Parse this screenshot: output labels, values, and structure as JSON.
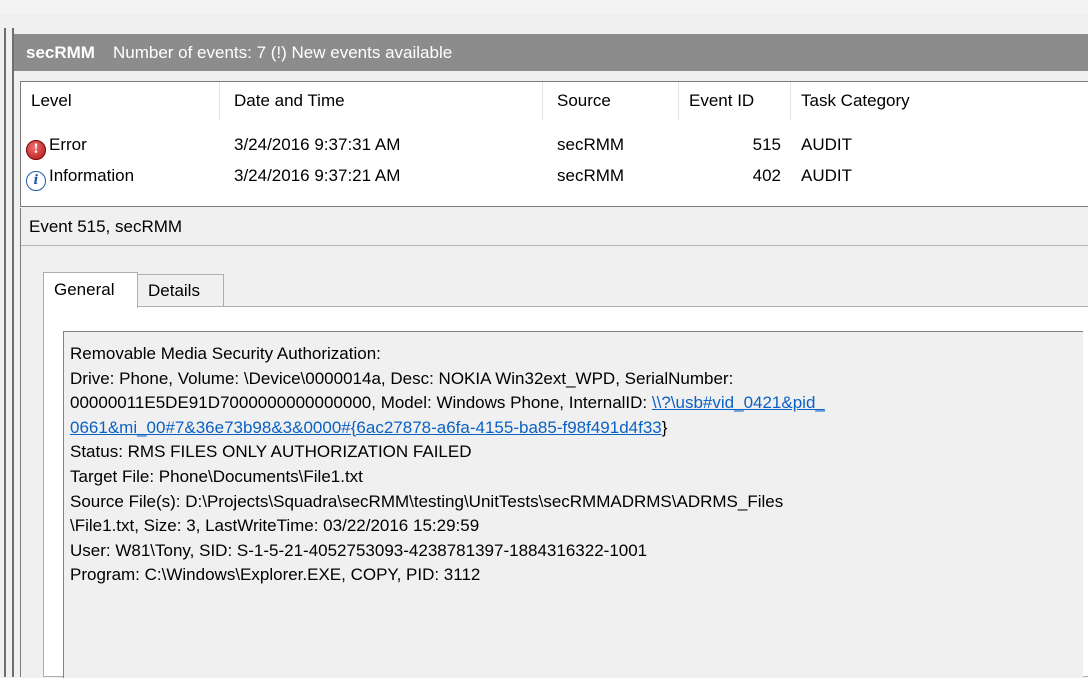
{
  "panel": {
    "app_name": "secRMM",
    "status_text": "Number of events: 7 (!) New events available"
  },
  "list": {
    "columns": [
      "Level",
      "Date and Time",
      "Source",
      "Event ID",
      "Task Category"
    ],
    "rows": [
      {
        "icon": "error-icon",
        "level": "Error",
        "datetime": "3/24/2016 9:37:31 AM",
        "source": "secRMM",
        "event_id": "515",
        "category": "AUDIT"
      },
      {
        "icon": "information-icon",
        "level": "Information",
        "datetime": "3/24/2016 9:37:21 AM",
        "source": "secRMM",
        "event_id": "402",
        "category": "AUDIT"
      }
    ]
  },
  "detail": {
    "title": "Event 515, secRMM",
    "tabs": [
      "General",
      "Details"
    ],
    "lines": {
      "l1": "Removable Media Security Authorization:",
      "l2": "Drive: Phone, Volume: \\Device\\0000014a, Desc: NOKIA Win32ext_WPD, SerialNumber:",
      "l3_text": "00000011E5DE91D7000000000000000, Model: Windows Phone, InternalID: ",
      "l3_link": "\\\\?\\usb#vid_0421&pid_",
      "l4_link": "0661&mi_00#7&36e73b98&3&0000#{6ac27878-a6fa-4155-ba85-f98f491d4f33",
      "l4_text": "}",
      "l5": "Status: RMS FILES ONLY AUTHORIZATION FAILED",
      "l6": "Target File: Phone\\Documents\\File1.txt",
      "l7": "Source File(s): D:\\Projects\\Squadra\\secRMM\\testing\\UnitTests\\secRMMADRMS\\ADRMS_Files",
      "l8": "\\File1.txt, Size: 3, LastWriteTime: 03/22/2016 15:29:59",
      "l9": "User: W81\\Tony, SID: S-1-5-21-4052753093-4238781397-1884316322-1001",
      "l10": "Program: C:\\Windows\\Explorer.EXE, COPY, PID: 3112"
    }
  }
}
